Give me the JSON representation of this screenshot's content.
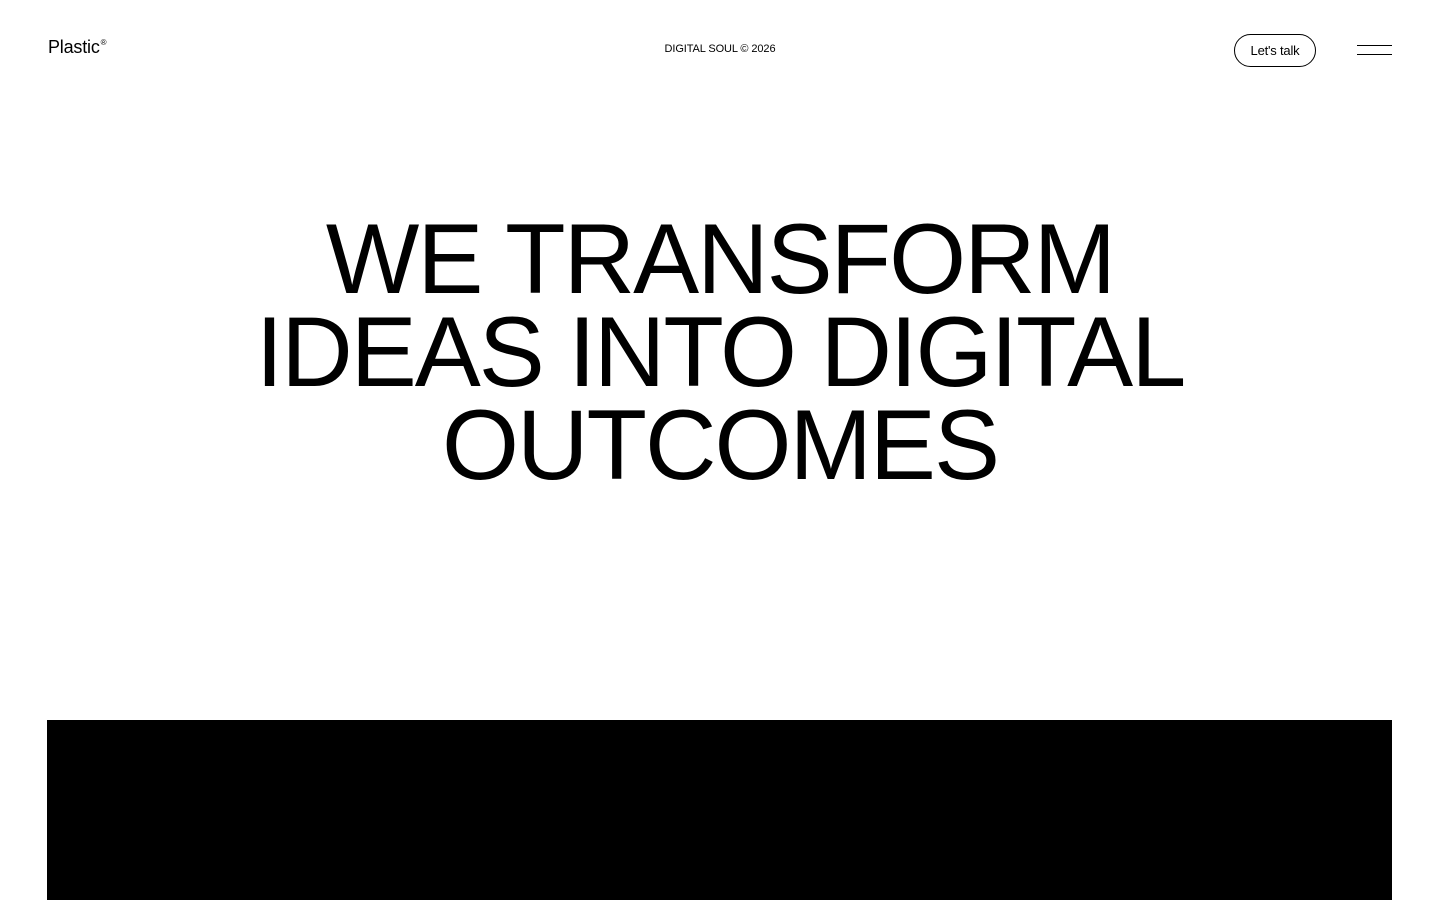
{
  "header": {
    "logo_text": "Plastic",
    "logo_mark": "®",
    "tagline": "DIGITAL SOUL © 2026",
    "cta_label": "Let's talk",
    "menu_icon": "hamburger-menu-icon"
  },
  "hero": {
    "lines": [
      "WE TRANSFORM",
      "IDEAS INTO DIGITAL",
      "OUTCOMES"
    ]
  },
  "colors": {
    "background": "#ffffff",
    "text": "#000000",
    "media_block": "#000000"
  }
}
